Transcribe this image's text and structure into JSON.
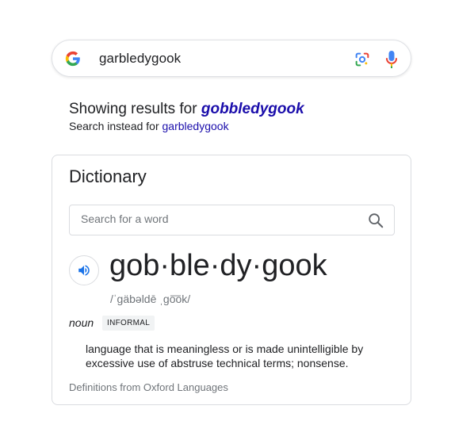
{
  "search": {
    "query": "garbledygook"
  },
  "correction": {
    "showing_prefix": "Showing results for",
    "corrected_query": "gobbledygook",
    "instead_prefix": "Search instead for",
    "original_query": "garbledygook"
  },
  "dictionary": {
    "title": "Dictionary",
    "search_placeholder": "Search for a word",
    "headword": "gob·ble·dy·gook",
    "pronunciation": "/ˈɡäbəldē ˌɡo͞ok/",
    "part_of_speech": "noun",
    "usage_label": "INFORMAL",
    "definition": "language that is meaningless or is made unintelligible by excessive use of abstruse technical terms; nonsense.",
    "source": "Definitions from Oxford Languages"
  },
  "icons": {
    "logo": "google-g-icon",
    "lens": "google-lens-icon",
    "mic": "microphone-icon",
    "search": "search-icon",
    "speaker": "speaker-icon"
  },
  "colors": {
    "link": "#1a0dab",
    "secondary_text": "#70757a",
    "border": "#dadce0",
    "speaker_blue": "#1a73e8"
  }
}
